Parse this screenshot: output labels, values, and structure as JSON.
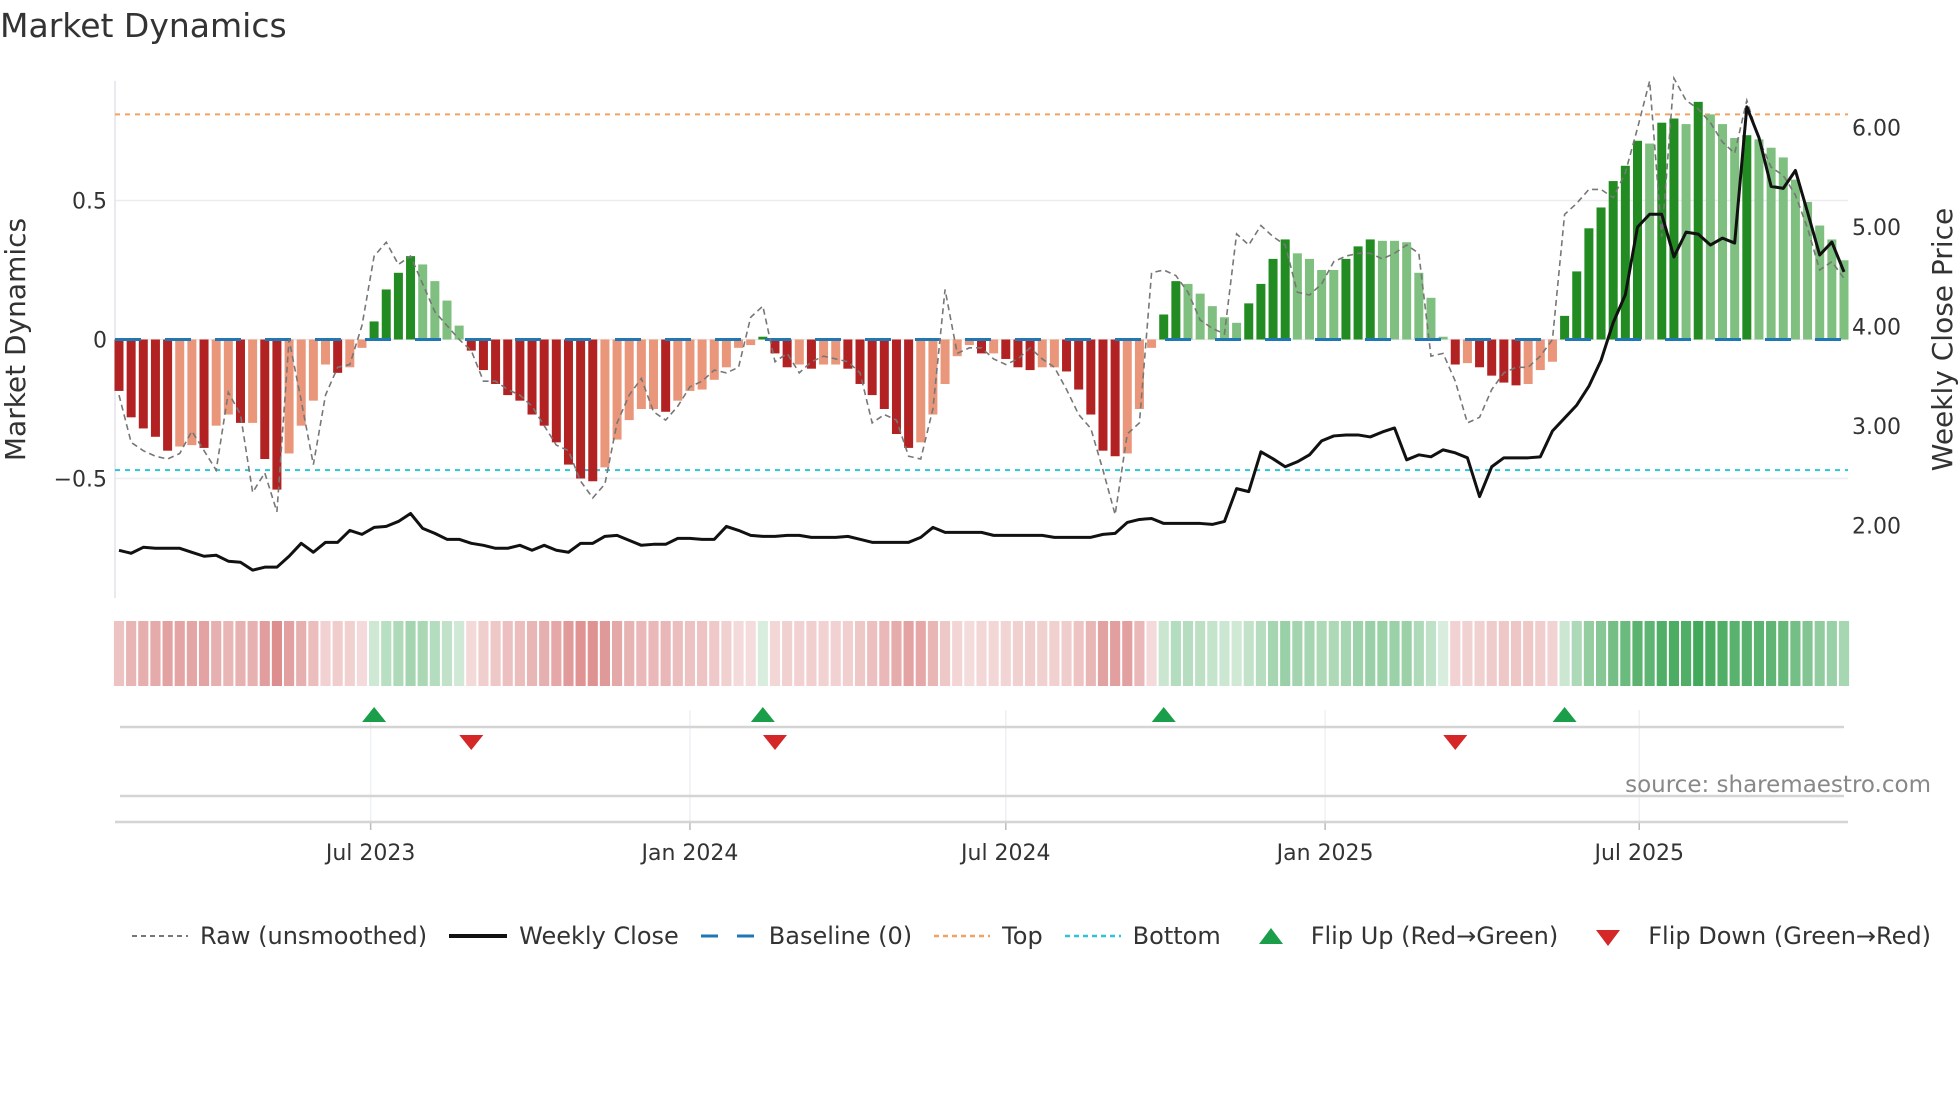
{
  "title": "Market Dynamics",
  "chart_data": {
    "type": "bar+line",
    "title": "Market Dynamics",
    "ylabel_left": "Market Dynamics",
    "ylabel_right": "Weekly Close Price",
    "ylim_left": [
      -0.93,
      0.93
    ],
    "ylim_right": [
      1.27,
      6.47
    ],
    "yticks_left": [
      {
        "v": 0.5,
        "label": "0.5"
      },
      {
        "v": 0,
        "label": "0"
      },
      {
        "v": -0.5,
        "label": "−0.5"
      }
    ],
    "yticks_right": [
      {
        "v": 6,
        "label": "6.00"
      },
      {
        "v": 5,
        "label": "5.00"
      },
      {
        "v": 4,
        "label": "4.00"
      },
      {
        "v": 3,
        "label": "3.00"
      },
      {
        "v": 2,
        "label": "2.00"
      }
    ],
    "start_date": "2023-02-06",
    "frequency": "weekly",
    "xticks": [
      {
        "date": "2023-07-01",
        "label": "Jul 2023"
      },
      {
        "date": "2024-01-01",
        "label": "Jan 2024"
      },
      {
        "date": "2024-07-01",
        "label": "Jul 2024"
      },
      {
        "date": "2025-01-01",
        "label": "Jan 2025"
      },
      {
        "date": "2025-07-01",
        "label": "Jul 2025"
      }
    ],
    "top_level": 0.81,
    "bottom_level": -0.47,
    "baseline": 0,
    "smoothed": [
      -0.185,
      -0.28,
      -0.32,
      -0.35,
      -0.4,
      -0.385,
      -0.38,
      -0.39,
      -0.31,
      -0.27,
      -0.3,
      -0.3,
      -0.43,
      -0.54,
      -0.41,
      -0.31,
      -0.22,
      -0.09,
      -0.12,
      -0.1,
      -0.03,
      0.065,
      0.18,
      0.24,
      0.3,
      0.27,
      0.21,
      0.14,
      0.05,
      -0.04,
      -0.11,
      -0.16,
      -0.2,
      -0.22,
      -0.27,
      -0.31,
      -0.37,
      -0.45,
      -0.5,
      -0.51,
      -0.46,
      -0.36,
      -0.29,
      -0.25,
      -0.25,
      -0.26,
      -0.22,
      -0.185,
      -0.18,
      -0.145,
      -0.1,
      -0.03,
      -0.02,
      0.01,
      -0.05,
      -0.1,
      -0.09,
      -0.105,
      -0.09,
      -0.09,
      -0.105,
      -0.16,
      -0.2,
      -0.25,
      -0.34,
      -0.39,
      -0.37,
      -0.27,
      -0.16,
      -0.06,
      -0.02,
      -0.05,
      -0.05,
      -0.07,
      -0.1,
      -0.11,
      -0.1,
      -0.1,
      -0.115,
      -0.18,
      -0.27,
      -0.4,
      -0.42,
      -0.41,
      -0.25,
      -0.03,
      0.09,
      0.21,
      0.2,
      0.165,
      0.12,
      0.08,
      0.06,
      0.13,
      0.2,
      0.29,
      0.36,
      0.31,
      0.29,
      0.25,
      0.25,
      0.29,
      0.335,
      0.36,
      0.355,
      0.355,
      0.35,
      0.24,
      0.15,
      0.01,
      -0.09,
      -0.085,
      -0.1,
      -0.13,
      -0.155,
      -0.165,
      -0.16,
      -0.11,
      -0.08,
      0.085,
      0.245,
      0.4,
      0.475,
      0.57,
      0.625,
      0.715,
      0.705,
      0.78,
      0.795,
      0.775,
      0.855,
      0.81,
      0.775,
      0.725,
      0.735,
      0.72,
      0.69,
      0.655,
      0.575,
      0.495,
      0.41,
      0.36,
      0.285
    ],
    "raw": [
      -0.2,
      -0.37,
      -0.4,
      -0.42,
      -0.43,
      -0.41,
      -0.33,
      -0.4,
      -0.47,
      -0.19,
      -0.27,
      -0.55,
      -0.48,
      -0.62,
      0.0,
      -0.22,
      -0.45,
      -0.2,
      -0.1,
      -0.09,
      0.05,
      0.3,
      0.35,
      0.27,
      0.3,
      0.2,
      0.1,
      0.05,
      0.0,
      -0.04,
      -0.15,
      -0.15,
      -0.18,
      -0.2,
      -0.24,
      -0.31,
      -0.38,
      -0.4,
      -0.51,
      -0.57,
      -0.52,
      -0.3,
      -0.2,
      -0.14,
      -0.26,
      -0.29,
      -0.24,
      -0.17,
      -0.15,
      -0.11,
      -0.12,
      -0.1,
      0.08,
      0.12,
      -0.08,
      -0.05,
      -0.12,
      -0.08,
      -0.06,
      -0.07,
      -0.08,
      -0.12,
      -0.3,
      -0.27,
      -0.29,
      -0.42,
      -0.43,
      -0.25,
      0.18,
      -0.05,
      -0.03,
      -0.03,
      -0.07,
      -0.09,
      -0.07,
      -0.03,
      -0.07,
      -0.1,
      -0.18,
      -0.27,
      -0.32,
      -0.47,
      -0.63,
      -0.34,
      -0.3,
      0.24,
      0.25,
      0.23,
      0.17,
      0.07,
      0.04,
      0.02,
      0.38,
      0.34,
      0.41,
      0.37,
      0.34,
      0.17,
      0.16,
      0.2,
      0.28,
      0.3,
      0.31,
      0.31,
      0.29,
      0.31,
      0.34,
      0.31,
      -0.06,
      -0.05,
      -0.15,
      -0.3,
      -0.28,
      -0.18,
      -0.12,
      -0.1,
      -0.1,
      -0.06,
      0.0,
      0.45,
      0.49,
      0.54,
      0.54,
      0.51,
      0.6,
      0.76,
      0.93,
      0.37,
      0.94,
      0.86,
      0.83,
      0.78,
      0.71,
      0.67,
      0.86,
      0.72,
      0.62,
      0.59,
      0.52,
      0.4,
      0.25,
      0.28,
      0.22
    ],
    "weekly_close": [
      1.75,
      1.72,
      1.78,
      1.77,
      1.77,
      1.77,
      1.73,
      1.69,
      1.7,
      1.64,
      1.63,
      1.55,
      1.58,
      1.58,
      1.69,
      1.82,
      1.73,
      1.83,
      1.83,
      1.95,
      1.91,
      1.98,
      1.99,
      2.04,
      2.12,
      1.97,
      1.92,
      1.86,
      1.86,
      1.82,
      1.8,
      1.77,
      1.77,
      1.8,
      1.75,
      1.8,
      1.75,
      1.73,
      1.82,
      1.82,
      1.89,
      1.9,
      1.85,
      1.8,
      1.81,
      1.81,
      1.87,
      1.87,
      1.86,
      1.86,
      1.99,
      1.95,
      1.9,
      1.89,
      1.89,
      1.9,
      1.9,
      1.88,
      1.88,
      1.88,
      1.89,
      1.86,
      1.83,
      1.83,
      1.83,
      1.83,
      1.88,
      1.98,
      1.93,
      1.93,
      1.93,
      1.93,
      1.9,
      1.9,
      1.9,
      1.9,
      1.9,
      1.88,
      1.88,
      1.88,
      1.88,
      1.91,
      1.92,
      2.03,
      2.06,
      2.07,
      2.02,
      2.02,
      2.02,
      2.02,
      2.01,
      2.04,
      2.37,
      2.34,
      2.74,
      2.67,
      2.59,
      2.64,
      2.71,
      2.85,
      2.9,
      2.91,
      2.91,
      2.89,
      2.94,
      2.98,
      2.66,
      2.71,
      2.69,
      2.76,
      2.73,
      2.68,
      2.29,
      2.59,
      2.68,
      2.68,
      2.68,
      2.69,
      2.95,
      3.08,
      3.21,
      3.4,
      3.66,
      4.04,
      4.32,
      5.0,
      5.13,
      5.13,
      4.7,
      4.95,
      4.93,
      4.82,
      4.89,
      4.84,
      6.21,
      5.9,
      5.41,
      5.39,
      5.57,
      5.15,
      4.72,
      4.85,
      4.55
    ],
    "flip_up_weeks": [
      21,
      53,
      86,
      119
    ],
    "flip_down_weeks": [
      29,
      54,
      110
    ],
    "legend": [
      {
        "key": "raw",
        "label": "Raw (unsmoothed)"
      },
      {
        "key": "close",
        "label": "Weekly Close"
      },
      {
        "key": "baseline",
        "label": "Baseline (0)"
      },
      {
        "key": "top",
        "label": "Top"
      },
      {
        "key": "bottom",
        "label": "Bottom"
      },
      {
        "key": "flip_up",
        "label": "Flip Up (Red→Green)"
      },
      {
        "key": "flip_down",
        "label": "Flip Down (Green→Red)"
      }
    ],
    "legend_position": "bottom",
    "source": "source: sharemaestro.com",
    "colors": {
      "strong_neg": "#b22222",
      "weak_neg": "#e9967a",
      "strong_pos": "#228b22",
      "weak_pos": "#7fbf7f",
      "raw": "#777777",
      "close": "#111111",
      "baseline": "#1f77b4",
      "top": "#f4a261",
      "bottom": "#2ec4d6",
      "flip_up": "#1a9e4a",
      "flip_down": "#d62728",
      "heat_neg": "#c94b4b",
      "heat_pos": "#2e9e48"
    }
  }
}
